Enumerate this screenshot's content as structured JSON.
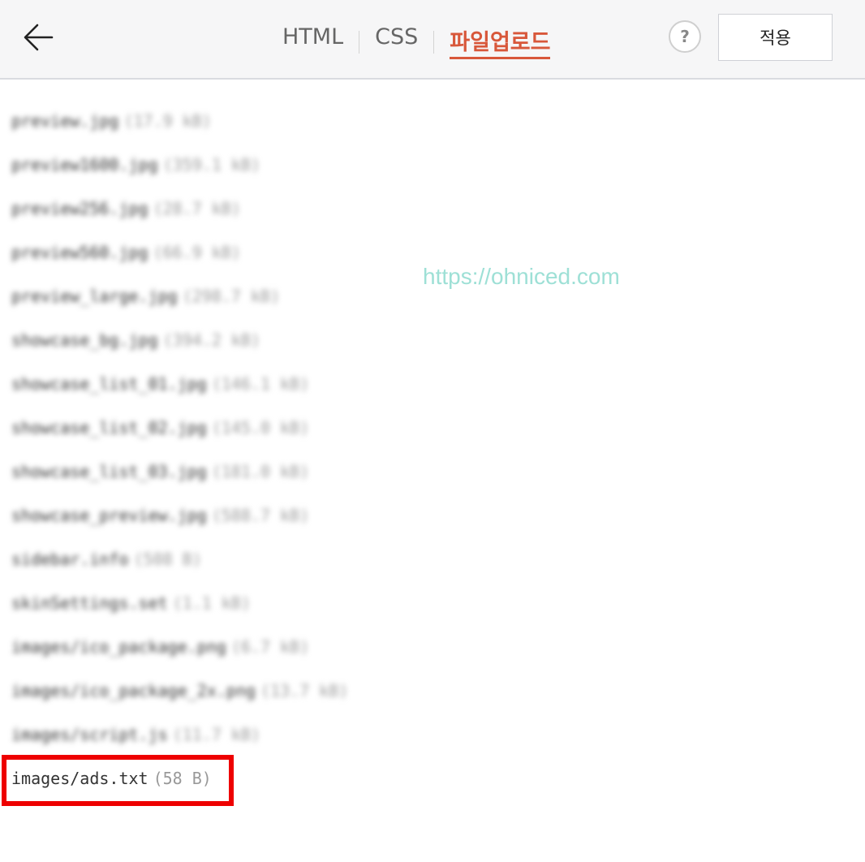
{
  "header": {
    "back_icon": "arrow-left-icon",
    "tabs": [
      {
        "label": "HTML",
        "active": false
      },
      {
        "label": "CSS",
        "active": false
      },
      {
        "label": "파일업로드",
        "active": true
      }
    ],
    "help_label": "?",
    "apply_label": "적용",
    "accent_color": "#d8573a"
  },
  "watermark": "https://ohniced.com",
  "files": [
    {
      "name": "preview.jpg",
      "size": "(17.9 kB)"
    },
    {
      "name": "preview1600.jpg",
      "size": "(359.1 kB)"
    },
    {
      "name": "preview256.jpg",
      "size": "(28.7 kB)"
    },
    {
      "name": "preview560.jpg",
      "size": "(66.9 kB)"
    },
    {
      "name": "preview_large.jpg",
      "size": "(298.7 kB)"
    },
    {
      "name": "showcase_bg.jpg",
      "size": "(394.2 kB)"
    },
    {
      "name": "showcase_list_01.jpg",
      "size": "(146.1 kB)"
    },
    {
      "name": "showcase_list_02.jpg",
      "size": "(145.0 kB)"
    },
    {
      "name": "showcase_list_03.jpg",
      "size": "(181.0 kB)"
    },
    {
      "name": "showcase_preview.jpg",
      "size": "(588.7 kB)"
    },
    {
      "name": "sidebar.info",
      "size": "(508 B)"
    },
    {
      "name": "skinSettings.set",
      "size": "(1.1 kB)"
    },
    {
      "name": "images/ico_package.png",
      "size": "(6.7 kB)"
    },
    {
      "name": "images/ico_package_2x.png",
      "size": "(13.7 kB)"
    },
    {
      "name": "images/script.js",
      "size": "(11.7 kB)"
    },
    {
      "name": "images/ads.txt",
      "size": "(58 B)"
    }
  ],
  "highlight_color": "#ee0000"
}
